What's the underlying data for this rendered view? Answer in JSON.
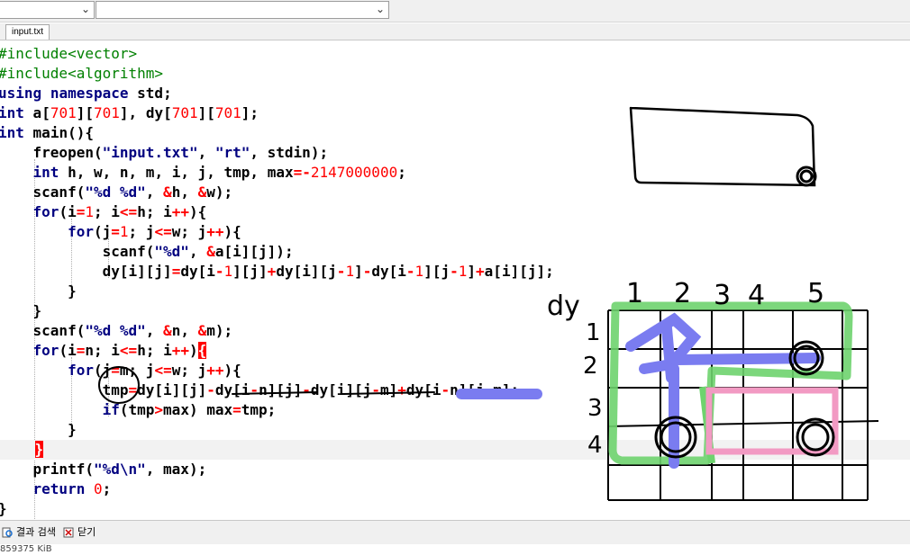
{
  "toolbar": {
    "combo1": "",
    "combo2": ""
  },
  "tab": {
    "label": "input.txt"
  },
  "code_lines": [
    "#include<vector>",
    "#include<algorithm>",
    "using namespace std;",
    "int a[701][701], dy[701][701];",
    "int main(){",
    "    freopen(\"input.txt\", \"rt\", stdin);",
    "    int h, w, n, m, i, j, tmp, max=-2147000000;",
    "    scanf(\"%d %d\", &h, &w);",
    "    for(i=1; i<=h; i++){",
    "        for(j=1; j<=w; j++){",
    "            scanf(\"%d\", &a[i][j]);",
    "            dy[i][j]=dy[i-1][j]+dy[i][j-1]-dy[i-1][j-1]+a[i][j];",
    "        }",
    "    }",
    "    scanf(\"%d %d\", &n, &m);",
    "    for(i=n; i<=h; i++){",
    "        for(j=m; j<=w; j++){",
    "            tmp=dy[i][j]-dy[i-n][j]-dy[i][j-m]+dy[i-n][j-m];",
    "            if(tmp>max) max=tmp;",
    "        }",
    "    }",
    "    printf(\"%d\\n\", max);",
    "    return 0;",
    "}"
  ],
  "bottom": {
    "search_results": "결과 검색",
    "close": "닫기"
  },
  "status": "859375 KiB",
  "sketch": {
    "dy_label": "dy",
    "column_labels": [
      "1",
      "2",
      "3",
      "4",
      "5"
    ],
    "row_labels": [
      "1",
      "2",
      "3",
      "4"
    ]
  },
  "colors": {
    "keyword": "#000080",
    "preprocessor": "#008000",
    "number": "#ff0000",
    "brace_highlight": "#ff0000",
    "ink_green": "#6ed36e",
    "ink_blue": "#7a7cf0",
    "ink_pink": "#f29ac3"
  }
}
